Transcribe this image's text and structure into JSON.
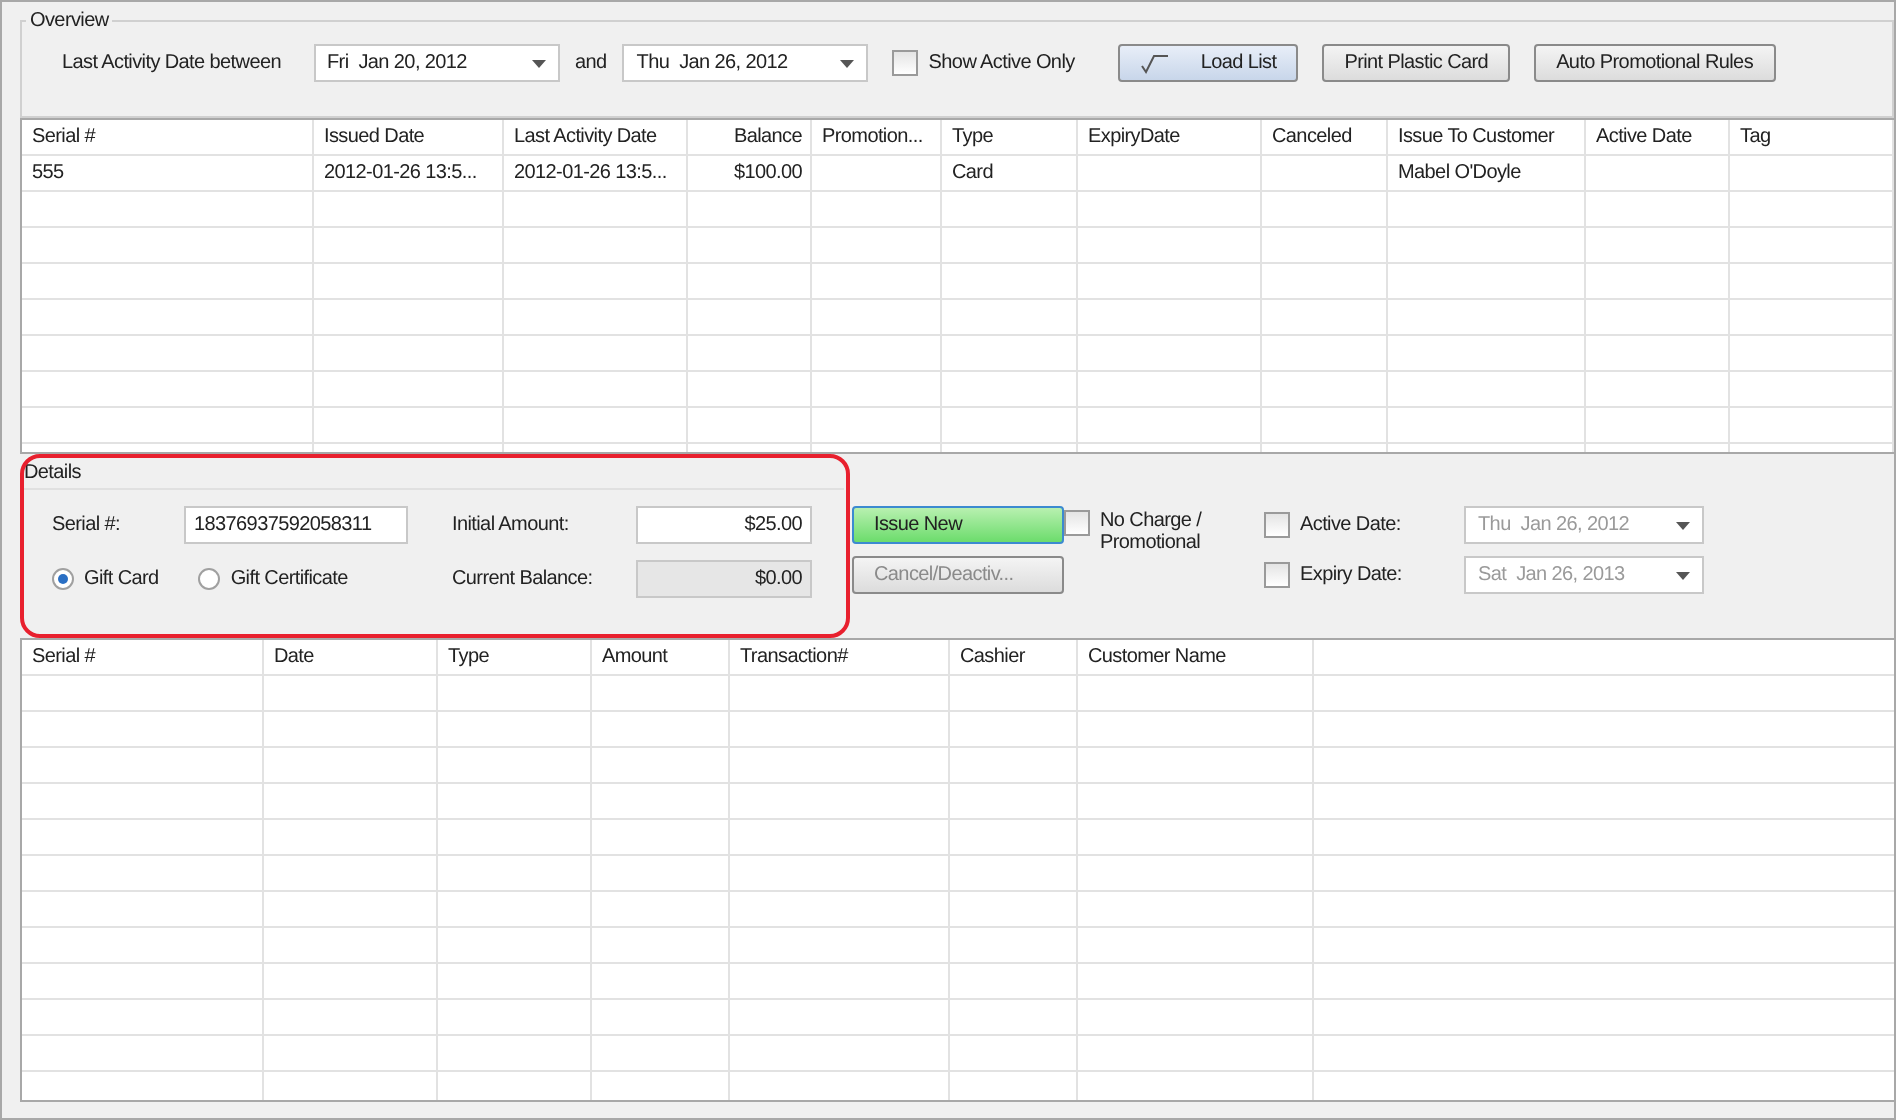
{
  "overview": {
    "title": "Overview",
    "range_label": "Last Activity Date between",
    "from_date": "Fri  Jan 20, 2012",
    "and_label": "and",
    "to_date": "Thu  Jan 26, 2012",
    "show_active_only": {
      "label": "Show Active Only",
      "checked": false
    },
    "buttons": [
      {
        "label": "Load List",
        "kind": "icon"
      },
      {
        "label": "Print Plastic Card",
        "kind": "plain"
      },
      {
        "label": "Auto Promotional Rules",
        "kind": "plain"
      }
    ]
  },
  "cards_table": {
    "columns": [
      "Serial #",
      "Issued Date",
      "Last Activity Date",
      "Balance",
      "Promotion...",
      "Type",
      "ExpiryDate",
      "Canceled",
      "Issue To Customer",
      "Active Date",
      "Tag"
    ],
    "rows": [
      {
        "serial": "555",
        "issued_date": "2012-01-26 13:5...",
        "last_activity_date": "2012-01-26 13:5...",
        "balance": "$100.00",
        "type": "Card",
        "issue_to_customer": "Mabel O'Doyle"
      }
    ]
  },
  "details": {
    "title": "Details",
    "serial_label": "Serial #:",
    "serial_value": "18376937592058311",
    "card_kinds": [
      {
        "label": "Gift Card",
        "selected": true
      },
      {
        "label": "Gift Certificate",
        "selected": false
      }
    ],
    "initial_amount_label": "Initial Amount:",
    "initial_amount": "$25.00",
    "current_balance_label": "Current Balance:",
    "current_balance": "$0.00",
    "buttons": [
      {
        "label": "Issue New",
        "kind": "primary",
        "disabled": false
      },
      {
        "label": "Cancel/Deactiv...",
        "kind": "plain",
        "disabled": true
      }
    ],
    "no_charge": {
      "label": "No Charge / Promotional",
      "checked": false
    },
    "active_date": {
      "label": "Active Date:",
      "checked": false,
      "value": "Thu  Jan 26, 2012",
      "disabled": true
    },
    "expiry_date": {
      "label": "Expiry Date:",
      "checked": false,
      "value": "Sat  Jan 26, 2013",
      "disabled": true
    }
  },
  "transactions_table": {
    "columns": [
      "Serial #",
      "Date",
      "Type",
      "Amount",
      "Transaction#",
      "Cashier",
      "Customer Name"
    ]
  }
}
